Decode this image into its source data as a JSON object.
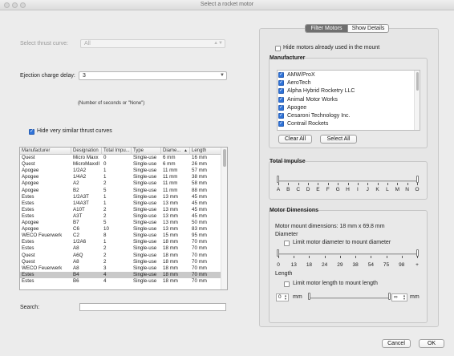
{
  "window": {
    "title": "Select a rocket motor"
  },
  "left": {
    "thrust_curve_label": "Select thrust curve:",
    "thrust_curve_value": "All",
    "ejection_label": "Ejection charge delay:",
    "ejection_value": "3",
    "ejection_hint": "(Number of seconds or \"None\")",
    "hide_similar_label": "Hide very similar thrust curves",
    "hide_similar_checked": true,
    "search_label": "Search:",
    "search_value": ""
  },
  "table": {
    "columns": [
      "Manufacturer",
      "Designation",
      "Total Impu...",
      "Type",
      "Diame...",
      "Length"
    ],
    "sort_indicator": "▲",
    "selected_row": 18,
    "rows": [
      [
        "Quest",
        "Micro Maxx",
        "0",
        "Single-use",
        "6 mm",
        "16 mm"
      ],
      [
        "Quest",
        "MicroMaxxII",
        "0",
        "Single-use",
        "6 mm",
        "26 mm"
      ],
      [
        "Apogee",
        "1/2A2",
        "1",
        "Single-use",
        "11 mm",
        "57 mm"
      ],
      [
        "Apogee",
        "1/4A2",
        "1",
        "Single-use",
        "11 mm",
        "38 mm"
      ],
      [
        "Apogee",
        "A2",
        "2",
        "Single-use",
        "11 mm",
        "58 mm"
      ],
      [
        "Apogee",
        "B2",
        "5",
        "Single-use",
        "11 mm",
        "88 mm"
      ],
      [
        "Estes",
        "1/2A3T",
        "1",
        "Single-use",
        "13 mm",
        "45 mm"
      ],
      [
        "Estes",
        "1/4A3T",
        "1",
        "Single-use",
        "13 mm",
        "45 mm"
      ],
      [
        "Estes",
        "A10T",
        "2",
        "Single-use",
        "13 mm",
        "45 mm"
      ],
      [
        "Estes",
        "A3T",
        "2",
        "Single-use",
        "13 mm",
        "45 mm"
      ],
      [
        "Apogee",
        "B7",
        "5",
        "Single-use",
        "13 mm",
        "50 mm"
      ],
      [
        "Apogee",
        "C6",
        "10",
        "Single-use",
        "13 mm",
        "83 mm"
      ],
      [
        "WECO Feuerwerk",
        "C2",
        "8",
        "Single-use",
        "15 mm",
        "95 mm"
      ],
      [
        "Estes",
        "1/2A6",
        "1",
        "Single-use",
        "18 mm",
        "70 mm"
      ],
      [
        "Estes",
        "A8",
        "2",
        "Single-use",
        "18 mm",
        "70 mm"
      ],
      [
        "Quest",
        "A6Q",
        "2",
        "Single-use",
        "18 mm",
        "70 mm"
      ],
      [
        "Quest",
        "A8",
        "2",
        "Single-use",
        "18 mm",
        "70 mm"
      ],
      [
        "WECO Feuerwerk",
        "A8",
        "3",
        "Single-use",
        "18 mm",
        "70 mm"
      ],
      [
        "Estes",
        "B4",
        "4",
        "Single-use",
        "18 mm",
        "70 mm"
      ],
      [
        "Estes",
        "B6",
        "4",
        "Single-use",
        "18 mm",
        "70 mm"
      ]
    ],
    "scroll_fraction": 0.0
  },
  "right": {
    "tabs": [
      "Filter Motors",
      "Show Details"
    ],
    "active_tab": 0,
    "hide_used_label": "Hide motors already used in the mount",
    "hide_used_checked": false,
    "manufacturer_title": "Manufacturer",
    "manufacturers": [
      {
        "name": "AMW/ProX",
        "checked": true
      },
      {
        "name": "AeroTech",
        "checked": true
      },
      {
        "name": "Alpha Hybrid Rocketry LLC",
        "checked": true
      },
      {
        "name": "Animal Motor Works",
        "checked": true
      },
      {
        "name": "Apogee",
        "checked": true
      },
      {
        "name": "Cesaroni Technology Inc.",
        "checked": true
      },
      {
        "name": "Contrail Rockets",
        "checked": true
      }
    ],
    "clear_all": "Clear All",
    "select_all": "Select All",
    "impulse_title": "Total Impulse",
    "impulse_scale": [
      "A",
      "B",
      "C",
      "D",
      "E",
      "F",
      "G",
      "H",
      "I",
      "J",
      "K",
      "L",
      "M",
      "N",
      "O"
    ],
    "dimensions_title": "Motor Dimensions",
    "mount_dimensions": "Motor mount dimensions: 18 mm x 69.8 mm",
    "diameter_label": "Diameter",
    "limit_diameter_label": "Limit motor diameter to mount diameter",
    "limit_diameter_checked": false,
    "diameter_scale": [
      "0",
      "13",
      "18",
      "24",
      "29",
      "38",
      "54",
      "75",
      "98",
      "+"
    ],
    "length_label": "Length",
    "limit_length_label": "Limit motor length to mount length",
    "limit_length_checked": false,
    "length_min": "0",
    "length_max": "∞",
    "length_unit": "mm"
  },
  "footer": {
    "cancel": "Cancel",
    "ok": "OK"
  },
  "icons": {
    "sort": "sort-ascending-icon",
    "checkmark": "checkmark-icon",
    "dropdown": "chevron-updown-icon"
  }
}
